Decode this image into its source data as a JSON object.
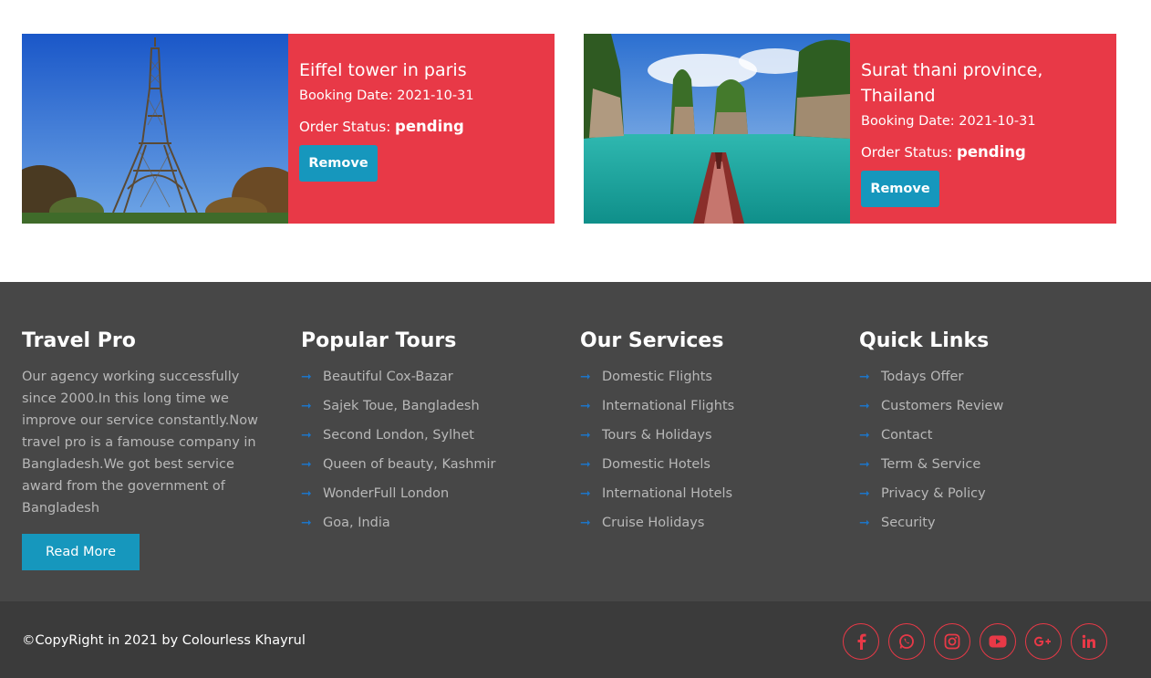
{
  "orders": [
    {
      "image_icon": "eiffel-tower-photo",
      "title": "Eiffel tower in paris",
      "booking_label": "Booking Date:",
      "booking_date": "2021-10-31",
      "status_label": "Order Status:",
      "status_value": "pending",
      "remove_label": "Remove"
    },
    {
      "image_icon": "thailand-lake-photo",
      "title": "Surat thani province, Thailand",
      "booking_label": "Booking Date:",
      "booking_date": "2021-10-31",
      "status_label": "Order Status:",
      "status_value": "pending",
      "remove_label": "Remove"
    }
  ],
  "footer": {
    "about": {
      "title": "Travel Pro",
      "text": "Our agency working successfully since 2000.In this long time we improve our service constantly.Now travel pro is a famouse company in Bangladesh.We got best service award from the government of Bangladesh",
      "button": "Read More"
    },
    "tours": {
      "title": "Popular Tours",
      "items": [
        "Beautiful Cox-Bazar",
        "Sajek Toue, Bangladesh",
        "Second London, Sylhet",
        "Queen of beauty, Kashmir",
        "WonderFull London",
        "Goa, India"
      ]
    },
    "services": {
      "title": "Our Services",
      "items": [
        "Domestic Flights",
        "International Flights",
        "Tours & Holidays",
        "Domestic Hotels",
        "International Hotels",
        "Cruise Holidays"
      ]
    },
    "links": {
      "title": "Quick Links",
      "items": [
        "Todays Offer",
        "Customers Review",
        "Contact",
        "Term & Service",
        "Privacy & Policy",
        "Security"
      ]
    },
    "arrow_icon": "long-arrow-right-icon",
    "arrow_glyph": "➞"
  },
  "bottom": {
    "copyright": "©CopyRight in 2021 by Colourless Khayrul",
    "social": [
      "facebook-icon",
      "whatsapp-icon",
      "instagram-icon",
      "youtube-icon",
      "google-plus-icon",
      "linkedin-icon"
    ]
  },
  "colors": {
    "card_red": "#e83947",
    "button_blue": "#1697bd",
    "footer_bg": "#474747",
    "bottom_bg": "#3b3b3b",
    "arrow_blue": "#1d75c7"
  }
}
